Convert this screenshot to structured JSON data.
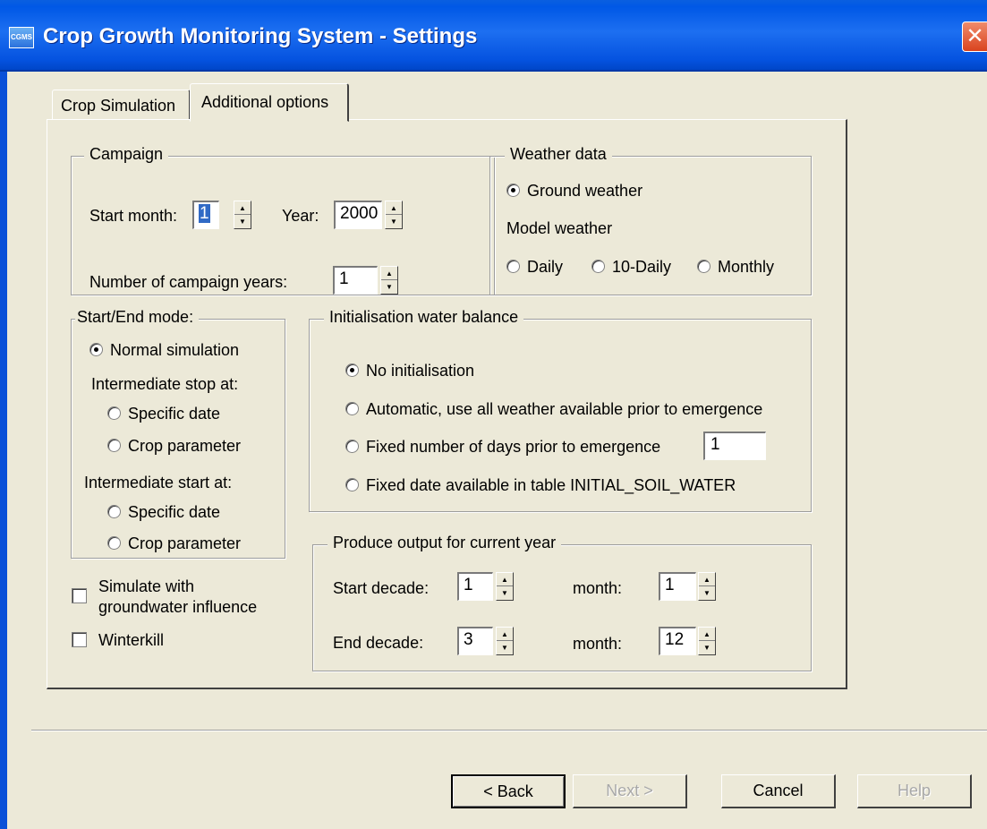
{
  "window": {
    "title": "Crop Growth Monitoring System - Settings",
    "icon_text": "CGMS",
    "close_glyph": "✕"
  },
  "tabs": [
    {
      "label": "Crop Simulation",
      "active": false
    },
    {
      "label": "Additional options",
      "active": true
    }
  ],
  "campaign": {
    "legend": "Campaign",
    "start_month_label": "Start month:",
    "start_month_value": "1",
    "year_label": "Year:",
    "year_value": "2000",
    "num_years_label": "Number of campaign years:",
    "num_years_value": "1"
  },
  "weather": {
    "legend": "Weather data",
    "ground_label": "Ground weather",
    "model_label": "Model weather",
    "daily_label": "Daily",
    "tendaily_label": "10-Daily",
    "monthly_label": "Monthly",
    "selected": "Ground weather"
  },
  "start_end": {
    "legend": "Start/End mode:",
    "normal_label": "Normal simulation",
    "stop_label": "Intermediate stop at:",
    "stop_specific": "Specific date",
    "stop_crop": "Crop parameter",
    "start_label": "Intermediate start at:",
    "start_specific": "Specific date",
    "start_crop": "Crop parameter",
    "selected": "Normal simulation"
  },
  "init_water": {
    "legend": "Initialisation water balance",
    "none_label": "No initialisation",
    "auto_label": "Automatic, use all weather available prior to emergence",
    "fixed_days_label": "Fixed number of days prior to emergence",
    "fixed_days_value": "1",
    "fixed_date_label": "Fixed date available in table INITIAL_SOIL_WATER",
    "selected": "No initialisation"
  },
  "output": {
    "legend": "Produce output for current year",
    "start_decade_label": "Start decade:",
    "start_decade_value": "1",
    "start_month_label": "month:",
    "start_month_value": "1",
    "end_decade_label": "End decade:",
    "end_decade_value": "3",
    "end_month_label": "month:",
    "end_month_value": "12"
  },
  "options": {
    "groundwater_line1": "Simulate with",
    "groundwater_line2": "groundwater influence",
    "groundwater_checked": false,
    "winterkill_label": "Winterkill",
    "winterkill_checked": false
  },
  "buttons": {
    "back": "< Back",
    "next": "Next >",
    "cancel": "Cancel",
    "help": "Help"
  }
}
